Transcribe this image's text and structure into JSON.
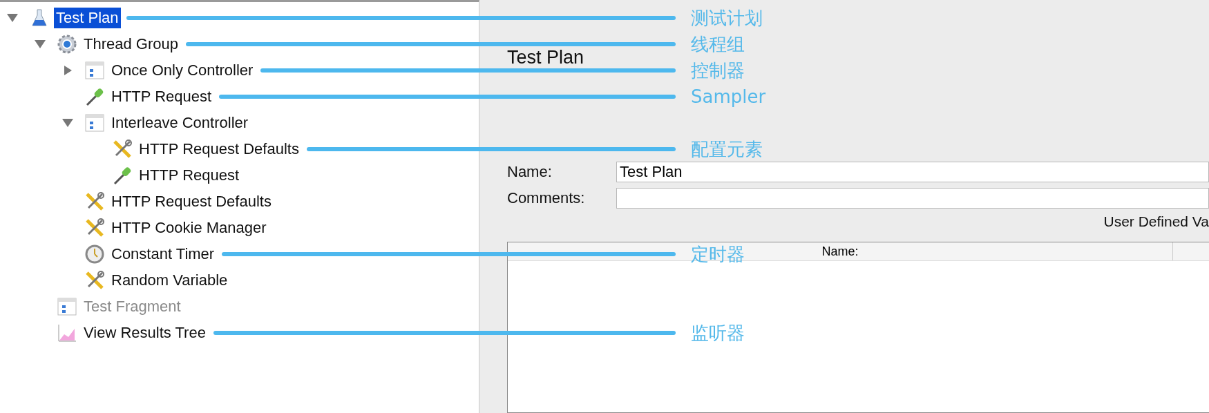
{
  "tree": [
    {
      "label": "Test Plan",
      "kind": "test-plan",
      "selected": true,
      "expanded": true,
      "annotation": "测试计划",
      "children": [
        {
          "label": "Thread Group",
          "kind": "thread-group",
          "selected": false,
          "expanded": true,
          "annotation": "线程组",
          "children": [
            {
              "label": "Once Only Controller",
              "kind": "controller",
              "selected": false,
              "expanded": false,
              "annotation": "控制器"
            },
            {
              "label": "HTTP Request",
              "kind": "sampler",
              "selected": false,
              "annotation": "Sampler"
            },
            {
              "label": "Interleave Controller",
              "kind": "controller",
              "selected": false,
              "expanded": true,
              "children": [
                {
                  "label": "HTTP Request Defaults",
                  "kind": "config",
                  "selected": false,
                  "annotation": "配置元素"
                },
                {
                  "label": "HTTP Request",
                  "kind": "sampler",
                  "selected": false
                }
              ]
            },
            {
              "label": "HTTP Request Defaults",
              "kind": "config",
              "selected": false
            },
            {
              "label": "HTTP Cookie Manager",
              "kind": "config",
              "selected": false
            },
            {
              "label": "Constant Timer",
              "kind": "timer",
              "selected": false,
              "annotation": "定时器"
            },
            {
              "label": "Random Variable",
              "kind": "config",
              "selected": false
            }
          ]
        },
        {
          "label": "Test Fragment",
          "kind": "controller",
          "selected": false,
          "disabled": true
        },
        {
          "label": "View Results Tree",
          "kind": "listener",
          "selected": false,
          "annotation": "监听器"
        }
      ]
    }
  ],
  "panel": {
    "title": "Test Plan",
    "fields": [
      {
        "label": "Name:",
        "value": "Test Plan"
      },
      {
        "label": "Comments:"
      }
    ],
    "section_title": "User Defined Va",
    "table": {
      "columns": [
        "Name:"
      ]
    }
  }
}
